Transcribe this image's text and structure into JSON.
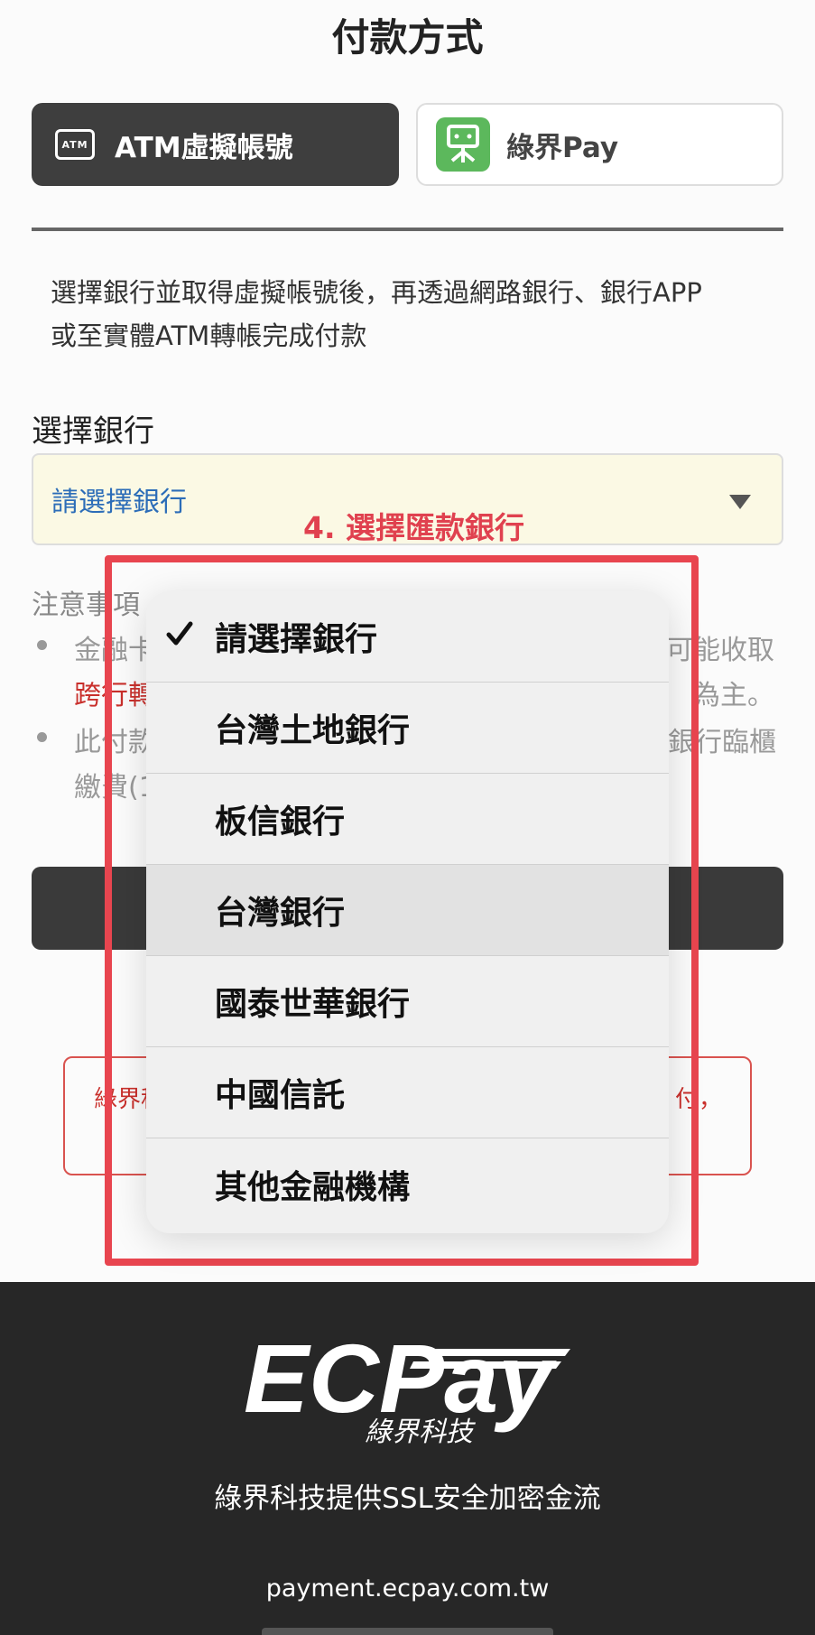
{
  "page": {
    "title": "付款方式"
  },
  "tabs": {
    "atm": {
      "label": "ATM虛擬帳號",
      "icon": "atm-card-icon",
      "icon_text": "ATM"
    },
    "ecpay": {
      "label": "綠界Pay",
      "icon": "ecpay-app-icon"
    }
  },
  "description": {
    "line1": "選擇銀行並取得虛擬帳號後，再透過網路銀行、銀行APP",
    "line2": "或至實體ATM轉帳完成付款"
  },
  "bank_select": {
    "label": "選擇銀行",
    "value": "請選擇銀行",
    "icon": "triangle-down-icon"
  },
  "annotation": {
    "text": "4. 選擇匯款銀行",
    "color": "#e8454f"
  },
  "notes": {
    "title": "注意事項",
    "line1_left": "金融卡",
    "line1_right": "可能收取",
    "line2_left": "跨行轉",
    "line2_right": "為主。",
    "line3_left": "此付款",
    "line3_right": "銀行臨櫃",
    "line4_left": "繳費(1"
  },
  "warning": {
    "left": "綠界科",
    "right": "付，"
  },
  "picker": {
    "selected_index": 0,
    "options": [
      "請選擇銀行",
      "台灣土地銀行",
      "板信銀行",
      "台灣銀行",
      "國泰世華銀行",
      "中國信託",
      "其他金融機構"
    ]
  },
  "footer": {
    "logo_text": "ECPay",
    "logo_subtitle": "綠界科技",
    "ssl_text": "綠界科技提供SSL安全加密金流",
    "url": "payment.ecpay.com.tw"
  },
  "colors": {
    "dark": "#3e3e3e",
    "accent_red": "#e8454f",
    "link_blue": "#2c6db8",
    "select_bg": "#fbf9e4",
    "ecpay_green": "#5cb85c"
  }
}
